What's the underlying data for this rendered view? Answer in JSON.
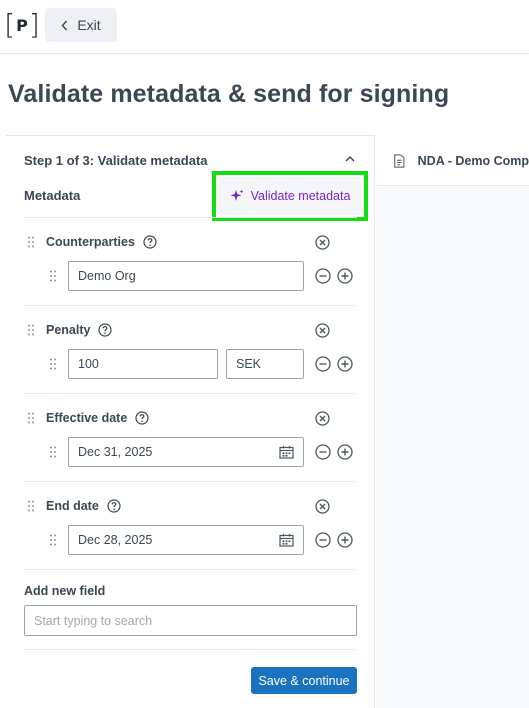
{
  "header": {
    "logo_letter": "P",
    "exit_label": "Exit"
  },
  "page_title": "Validate metadata & send for signing",
  "step": {
    "title": "Step 1 of 3: Validate metadata",
    "metadata_label": "Metadata",
    "validate_button": "Validate metadata"
  },
  "fields": {
    "counterparties": {
      "label": "Counterparties",
      "value": "Demo Org"
    },
    "penalty": {
      "label": "Penalty",
      "value": "100",
      "currency": "SEK"
    },
    "effective_date": {
      "label": "Effective date",
      "value": "Dec 31, 2025"
    },
    "end_date": {
      "label": "End date",
      "value": "Dec 28, 2025"
    }
  },
  "add_field": {
    "label": "Add new field",
    "placeholder": "Start typing to search"
  },
  "save_button": "Save & continue",
  "document": {
    "name": "NDA - Demo Comp"
  },
  "colors": {
    "accent_purple": "#7a27c9",
    "primary_blue": "#1a73c0",
    "highlight_green": "#14dd14"
  }
}
